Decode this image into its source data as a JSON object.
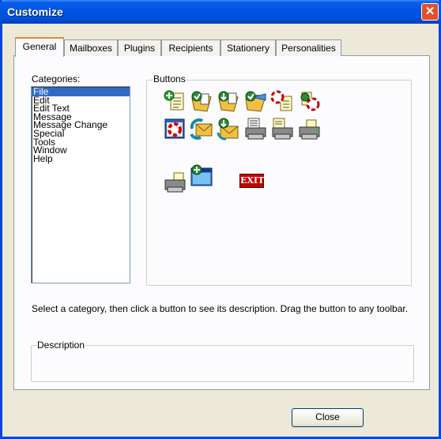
{
  "window": {
    "title": "Customize",
    "close_glyph": "✕"
  },
  "tabs": [
    {
      "label": "General",
      "active": true
    },
    {
      "label": "Mailboxes",
      "active": false
    },
    {
      "label": "Plugins",
      "active": false
    },
    {
      "label": "Recipients",
      "active": false
    },
    {
      "label": "Stationery",
      "active": false
    },
    {
      "label": "Personalities",
      "active": false
    }
  ],
  "categories": {
    "label": "Categories:",
    "items": [
      "File",
      "Edit",
      "Edit Text",
      "Message",
      "Message Change",
      "Special",
      "Tools",
      "Window",
      "Help"
    ],
    "selected": "File"
  },
  "buttons": {
    "label": "Buttons",
    "icons": [
      "new-message-icon",
      "open-mailbox-icon",
      "save-attachment-icon",
      "open-folder-icon",
      "lifebuoy-document-icon",
      "lifebuoy-search-icon",
      "lifebuoy-help-icon",
      "check-mail-icon",
      "send-queued-icon",
      "print-preview-icon",
      "print-setup-icon",
      "print-icon",
      "print-one-icon",
      "new-window-icon",
      "exit-icon"
    ],
    "exit_text": "EXIT"
  },
  "hint": "Select a category, then click a button to see its description. Drag the button to any toolbar.",
  "description": {
    "label": "Description",
    "value": ""
  },
  "footer": {
    "close_label": "Close"
  },
  "colors": {
    "title_bar": "#0054e3",
    "selection": "#316ac5",
    "active_tab_accent": "#e68b2c"
  }
}
